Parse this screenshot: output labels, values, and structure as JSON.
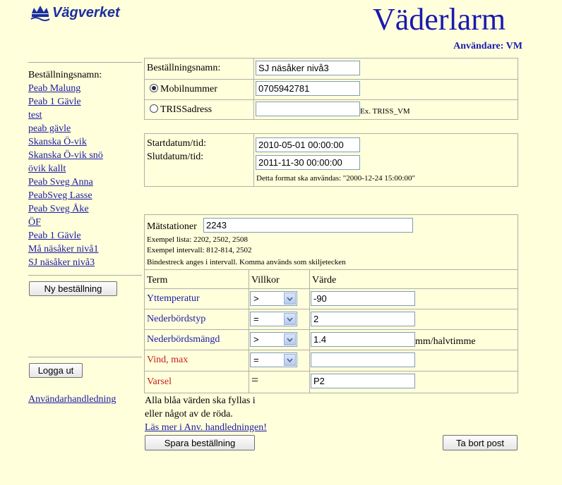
{
  "header": {
    "logo_text": "Vägverket",
    "title": "Väderlarm",
    "user": "Användare: VM"
  },
  "sidebar": {
    "label": "Beställningsnamn:",
    "items": [
      "Peab Malung",
      "Peab 1 Gävle",
      "test",
      "peab gävle",
      "Skanska Ö-vik",
      "Skanska Ö-vik snö",
      "övik kallt",
      "Peab Sveg Anna",
      "PeabSveg Lasse",
      "Peab Sveg Åke",
      "ÖF",
      "Peab 1 Gävle",
      "Må näsåker nivå1",
      "SJ näsåker nivå3"
    ],
    "new_order_button": "Ny beställning",
    "logout_button": "Logga ut",
    "user_guide_link": "Användarhandledning"
  },
  "order": {
    "name_label": "Beställningsnamn:",
    "name_value": "SJ näsåker nivå3",
    "mobile_label": "Mobilnummer",
    "mobile_value": "0705942781",
    "mobile_selected": true,
    "triss_label": "TRISSadress",
    "triss_value": "",
    "triss_example": "Ex. TRISS_VM"
  },
  "dates": {
    "start_label": "Startdatum/tid:",
    "start_value": "2010-05-01 00:00:00",
    "end_label": "Slutdatum/tid:",
    "end_value": "2011-11-30 00:00:00",
    "format_hint": "Detta format ska användas: \"2000-12-24 15:00:00\""
  },
  "stations": {
    "label": "Mätstationer",
    "value": "2243",
    "example_list": "Exempel lista: 2202, 2502, 2508",
    "example_interval": "Exempel intervall: 812-814, 2502",
    "hint": "Bindestreck anges i intervall. Komma används som skiljetecken"
  },
  "conditions": {
    "headers": {
      "term": "Term",
      "condition": "Villkor",
      "value": "Värde"
    },
    "rows": [
      {
        "term": "Yttemperatur",
        "condition": ">",
        "value": "-90",
        "unit": ""
      },
      {
        "term": "Nederbördstyp",
        "condition": "=",
        "value": "2",
        "unit": ""
      },
      {
        "term": "Nederbördsmängd",
        "condition": ">",
        "value": "1.4",
        "unit": "mm/halvtimme"
      },
      {
        "term": "Vind, max",
        "condition": "=",
        "value": "",
        "unit": ""
      },
      {
        "term": "Varsel",
        "condition": "=",
        "value": "P2",
        "unit": ""
      }
    ]
  },
  "footer": {
    "note_line1": "Alla blåa värden ska fyllas i",
    "note_line2": "eller något av de röda.",
    "read_more_link": "Läs mer i Anv. handledningen!",
    "save_button": "Spara beställning",
    "delete_button": "Ta bort post"
  },
  "colors": {
    "background": "#ffffdc",
    "link_blue": "#1a1aa6",
    "required_red": "#c81e1e",
    "title_blue": "#1a1ab0"
  }
}
